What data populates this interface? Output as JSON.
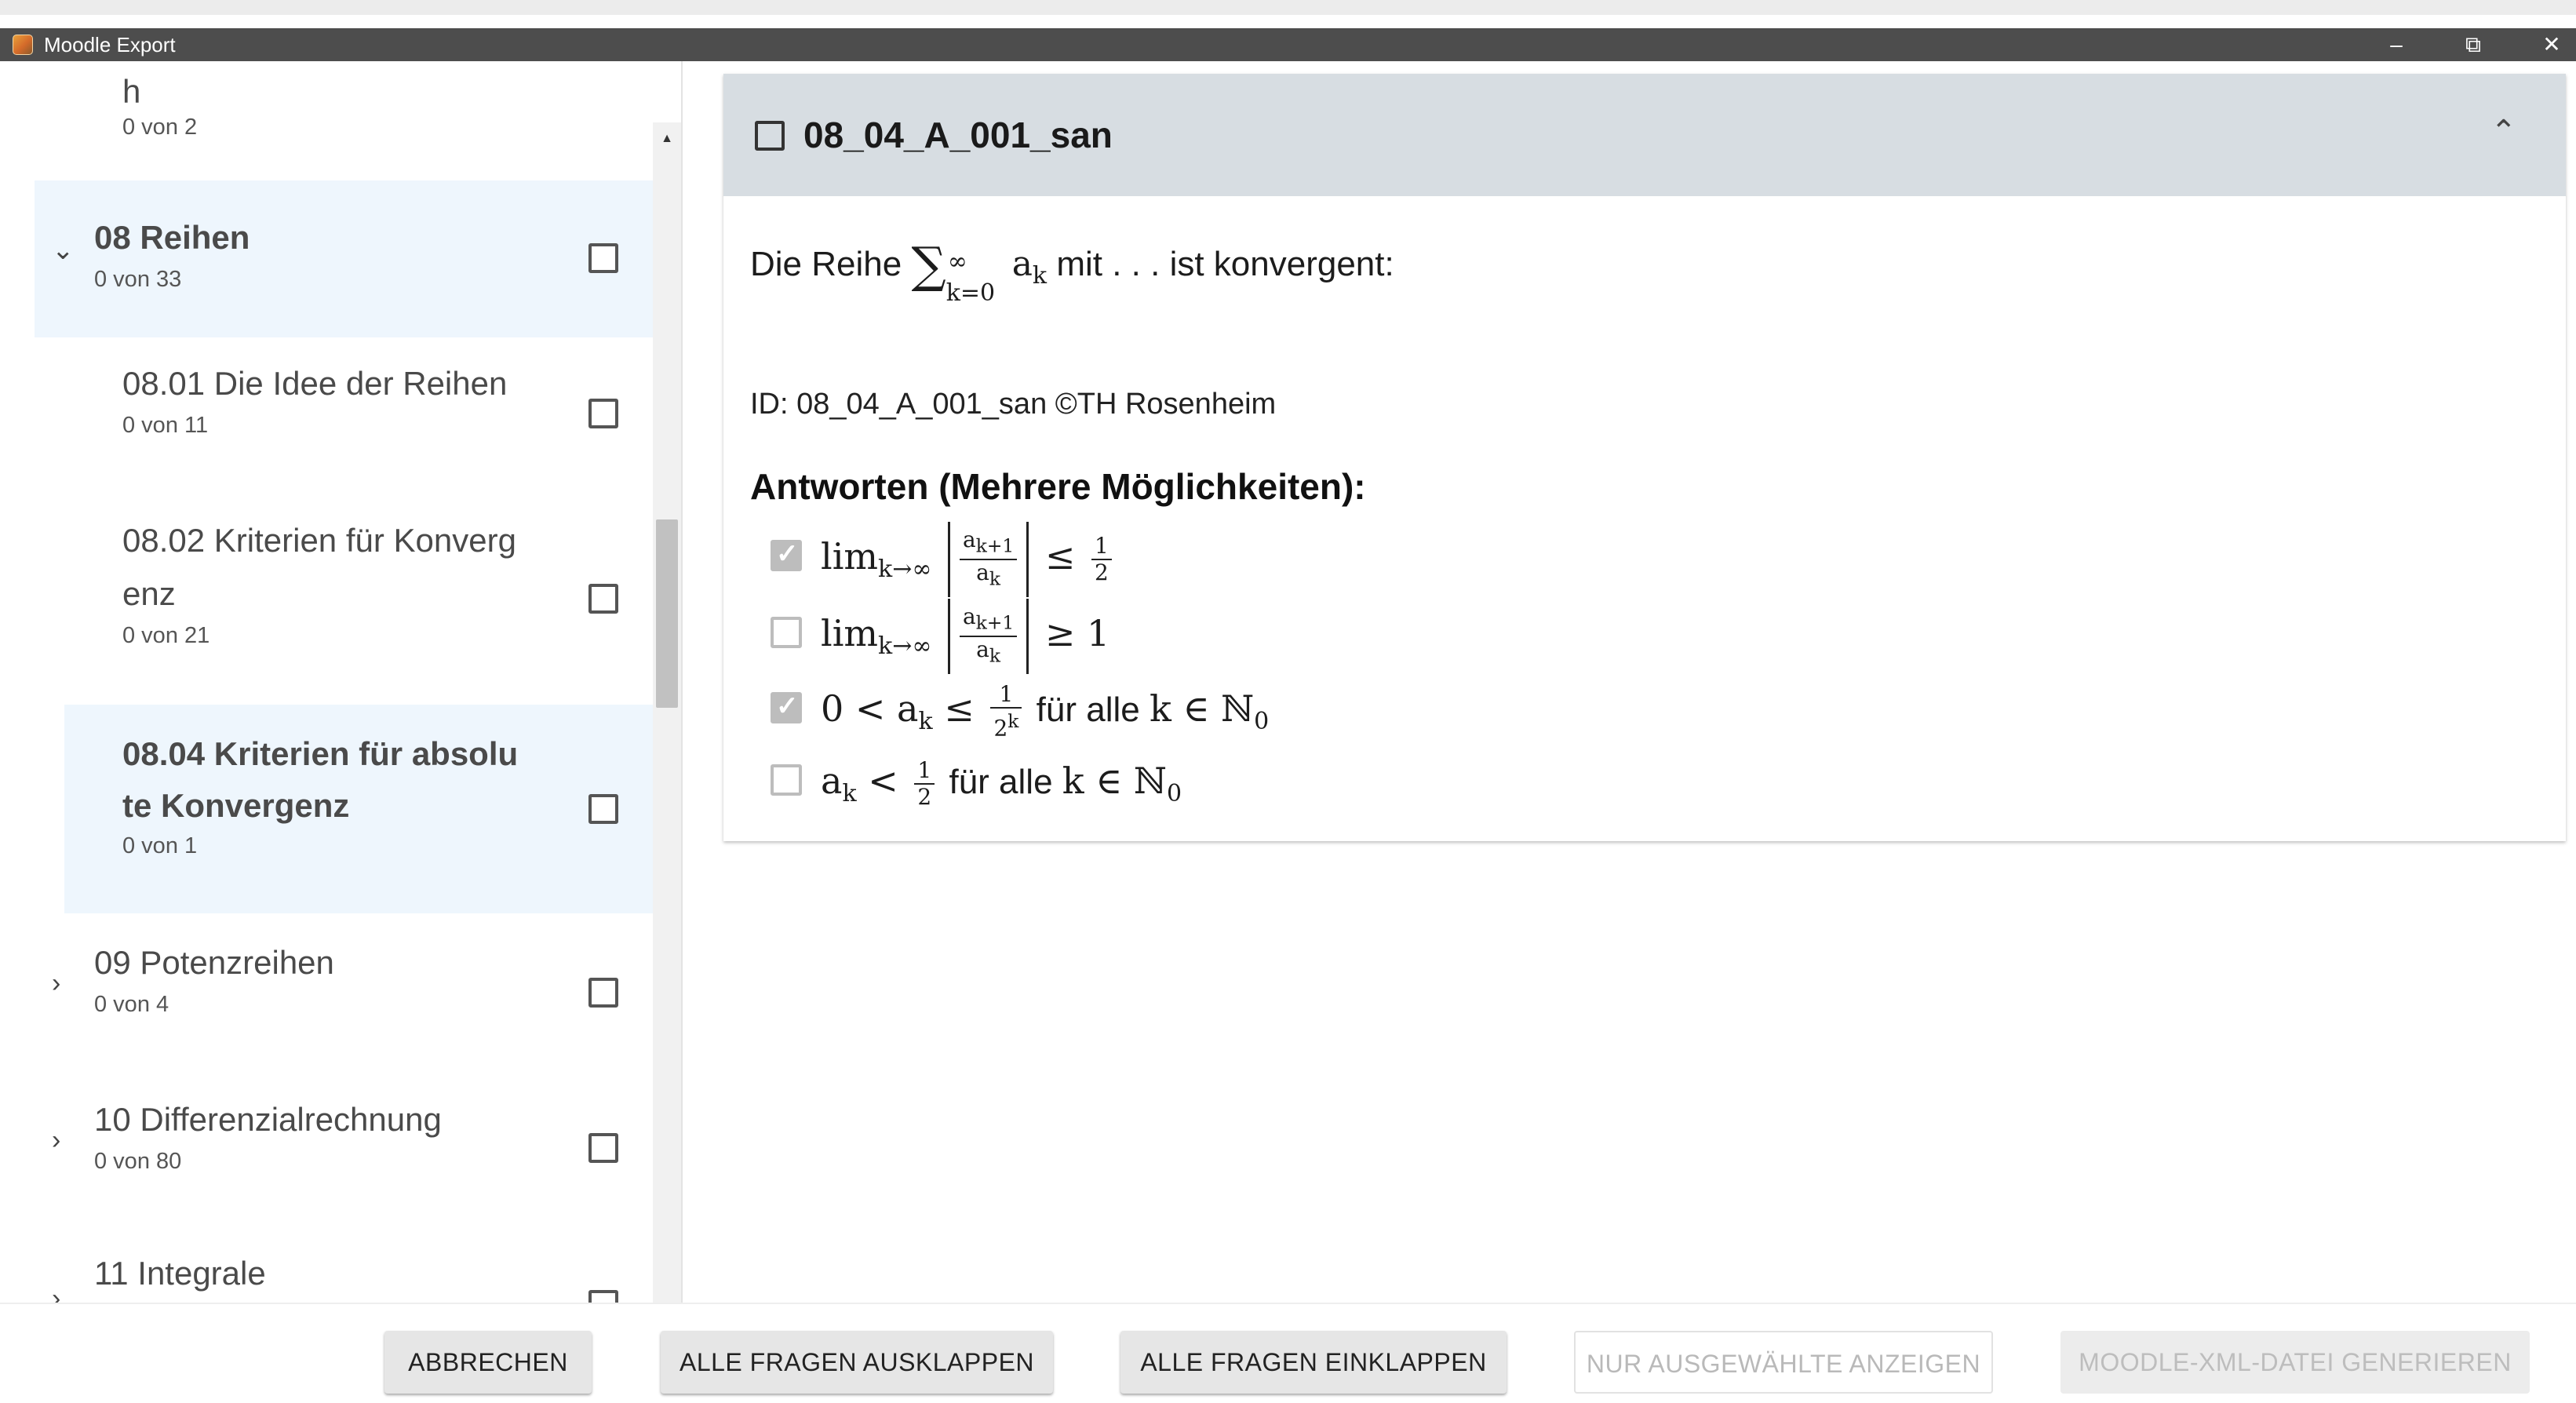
{
  "window": {
    "title": "Moodle Export",
    "minimize": "–",
    "maximize": "⧉",
    "close": "✕"
  },
  "sidebar": {
    "items": [
      {
        "label": "h",
        "count": "0 von 2",
        "chevron": ""
      },
      {
        "label": "08 Reihen",
        "count": "0 von 33",
        "chevron": "⌄"
      },
      {
        "label": "08.01 Die Idee der Reihen",
        "count": "0 von 11",
        "chevron": ""
      },
      {
        "label_line1": "08.02 Kriterien für Konverg",
        "label_line2": "enz",
        "count": "0 von 21",
        "chevron": ""
      },
      {
        "label_line1": "08.04 Kriterien für absolu",
        "label_line2": "te Konvergenz",
        "count": "0 von 1",
        "chevron": ""
      },
      {
        "label": "09 Potenzreihen",
        "count": "0 von 4",
        "chevron": "›"
      },
      {
        "label": "10 Differenzialrechnung",
        "count": "0 von 80",
        "chevron": "›"
      },
      {
        "label": "11 Integrale",
        "count": "",
        "chevron": "›"
      }
    ],
    "scroll_up": "▲",
    "scroll_down": "▼"
  },
  "question": {
    "title": "08_04_A_001_san",
    "collapse_icon": "⌃",
    "text_before": "Die Reihe ",
    "text_mit": " mit . . . ",
    "text_after": " ist konvergent:",
    "id_line": "ID: 08_04_A_001_san ©TH Rosenheim",
    "answers_heading": "Antworten (Mehrere Möglichkeiten):",
    "answers": [
      {
        "checked": true,
        "label": "lim k→∞ |a(k+1)/a(k)| ≤ 1/2"
      },
      {
        "checked": false,
        "label": "lim k→∞ |a(k+1)/a(k)| ≥ 1"
      },
      {
        "checked": true,
        "label": "0 < a(k) ≤ 1/2^k für alle k ∈ N0"
      },
      {
        "checked": false,
        "label": "a(k) < 1/2 für alle k ∈ N0"
      }
    ],
    "fuer_alle": " für alle "
  },
  "buttons": {
    "cancel": "ABBRECHEN",
    "expand_all": "ALLE FRAGEN AUSKLAPPEN",
    "collapse_all": "ALLE FRAGEN EINKLAPPEN",
    "show_selected": "NUR AUSGEWÄHLTE ANZEIGEN",
    "generate_xml": "MOODLE-XML-DATEI GENERIEREN"
  },
  "colors": {
    "titlebar": "#4d4d4d",
    "selected_item": "#eef6fd",
    "card_header": "#d7dde2",
    "checked_box": "#bdbdbd"
  }
}
